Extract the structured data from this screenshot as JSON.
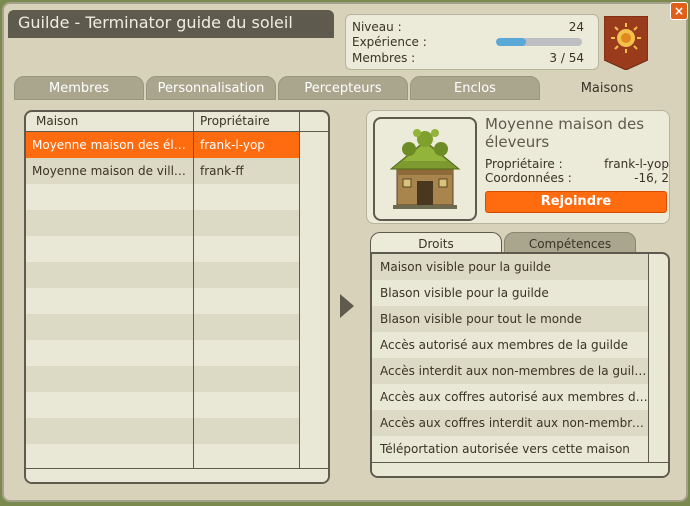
{
  "window": {
    "title": "Guilde - Terminator guide du soleil",
    "close_label": "×"
  },
  "stats": {
    "level_label": "Niveau :",
    "level_value": "24",
    "xp_label": "Expérience :",
    "xp_progress": 0.35,
    "members_label": "Membres :",
    "members_value": "3 / 54"
  },
  "tabs": [
    {
      "label": "Membres",
      "active": false
    },
    {
      "label": "Personnalisation",
      "active": false
    },
    {
      "label": "Percepteurs",
      "active": false
    },
    {
      "label": "Enclos",
      "active": false
    },
    {
      "label": "Maisons",
      "active": true
    }
  ],
  "houses_table": {
    "columns": [
      "Maison",
      "Propriétaire"
    ],
    "rows": [
      {
        "house": "Moyenne maison des éleveurs",
        "owner": "frank-l-yop",
        "selected": true
      },
      {
        "house": "Moyenne maison de village",
        "owner": "frank-ff",
        "selected": false
      }
    ]
  },
  "house_detail": {
    "name": "Moyenne maison des éleveurs",
    "owner_label": "Propriétaire :",
    "owner_value": "frank-l-yop",
    "coords_label": "Coordonnées :",
    "coords_value": "-16, 2",
    "join_label": "Rejoindre"
  },
  "right_tabs": [
    {
      "label": "Droits",
      "active": true
    },
    {
      "label": "Compétences",
      "active": false
    }
  ],
  "rights": [
    "Maison visible pour la guilde",
    "Blason visible pour la guilde",
    "Blason visible pour tout le monde",
    "Accès autorisé aux membres de la guilde",
    "Accès interdit aux non-membres de la guilde",
    "Accès aux coffres autorisé aux membres de la guilde",
    "Accès aux coffres interdit aux non-membres de la guilde",
    "Téléportation autorisée vers cette maison"
  ],
  "colors": {
    "accent": "#ff6c10",
    "panel": "#d7d2b9",
    "dark": "#5e5a4e",
    "banner": "#9a3b1c"
  }
}
